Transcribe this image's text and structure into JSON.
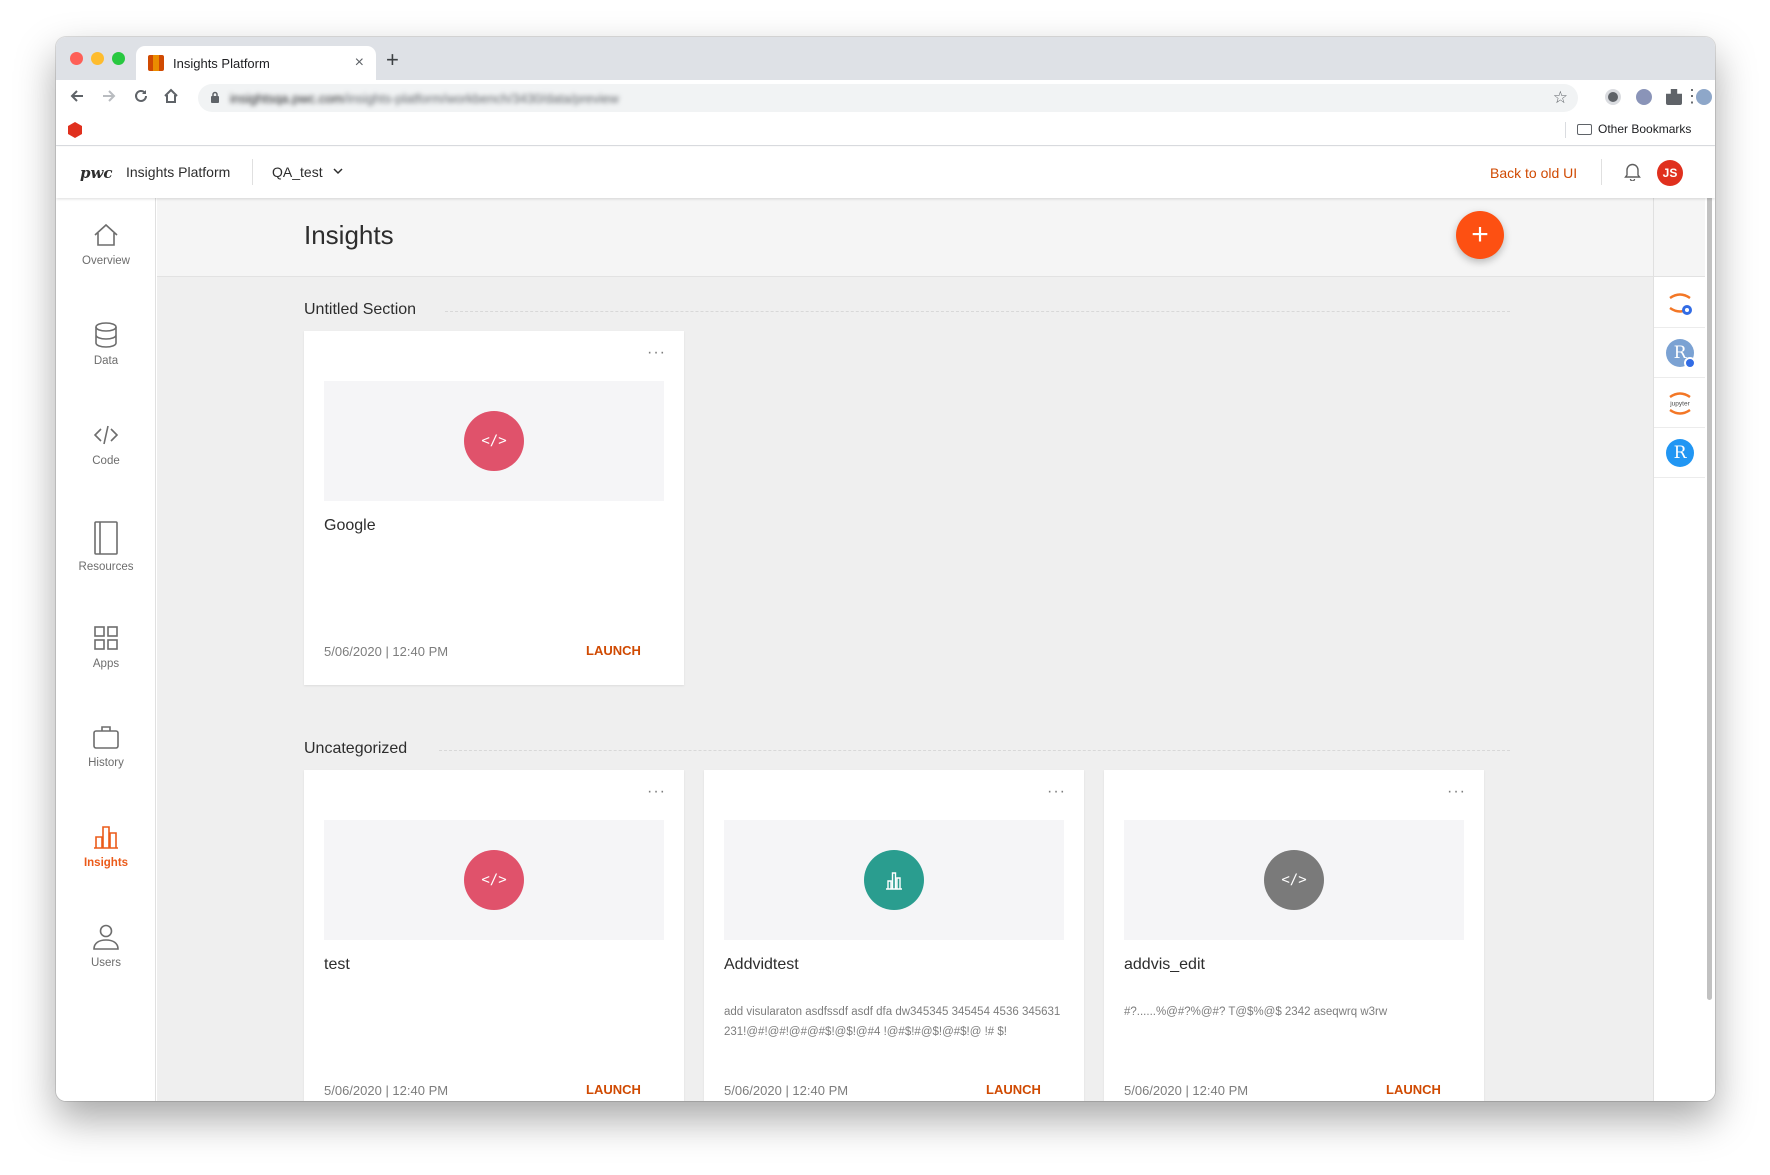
{
  "browser": {
    "tab_title": "Insights Platform",
    "tab_close": "×",
    "new_tab": "+",
    "url_host": "insightsqa.pwc.com",
    "url_path": "/insights-platform/workbench/3430/data/preview",
    "bookmark_other": "Other Bookmarks",
    "traffic_lights": [
      "#fe5f57",
      "#febc2e",
      "#28c840"
    ]
  },
  "header": {
    "logo": "pwc",
    "app_name": "Insights Platform",
    "workspace": "QA_test",
    "back_link": "Back to old UI",
    "avatar_initials": "JS"
  },
  "sidenav": {
    "items": [
      {
        "label": "Overview",
        "icon": "home-icon"
      },
      {
        "label": "Data",
        "icon": "database-icon"
      },
      {
        "label": "Code",
        "icon": "code-icon"
      },
      {
        "label": "Resources",
        "icon": "book-icon"
      },
      {
        "label": "Apps",
        "icon": "grid-icon"
      },
      {
        "label": "History",
        "icon": "briefcase-icon"
      },
      {
        "label": "Insights",
        "icon": "bar-chart-icon",
        "active": true
      },
      {
        "label": "Users",
        "icon": "user-icon"
      }
    ]
  },
  "main": {
    "title": "Insights",
    "fab_label": "+",
    "sections": [
      {
        "title": "Untitled Section",
        "cards": [
          {
            "title": "Google",
            "icon": "</>",
            "icon_color": "#e0526b",
            "description": "",
            "date": "5/06/2020 | 12:40 PM",
            "action": "LAUNCH"
          }
        ]
      },
      {
        "title": "Uncategorized",
        "cards": [
          {
            "title": "test",
            "icon": "</>",
            "icon_color": "#e0526b",
            "description": "",
            "date": "5/06/2020 | 12:40 PM",
            "action": "LAUNCH"
          },
          {
            "title": "Addvidtest",
            "icon": "bar-chart-icon",
            "icon_color": "#2a9d8f",
            "description": "add visularaton asdfssdf asdf dfa dw345345 345454 4536 345631231!@#!@#!@#@#$!@$!@#4 !@#$!#@$!@#$!@ !# $!",
            "date": "5/06/2020 | 12:40 PM",
            "action": "LAUNCH"
          },
          {
            "title": "addvis_edit",
            "icon": "</>",
            "icon_color": "#7a7a7a",
            "description": "#?......%@#?%@#? T@$%@$ 2342 aseqwrq w3rw",
            "date": "5/06/2020 | 12:40 PM",
            "action": "LAUNCH"
          }
        ]
      }
    ]
  },
  "rail": {
    "items": [
      "jupyter-k8s-icon",
      "r-k8s-icon",
      "jupyter-icon",
      "r-icon"
    ],
    "r_letter": "R",
    "jupyter_word": "jupyter"
  },
  "colors": {
    "accent": "#d04a02",
    "fab": "#fd5012",
    "active_nav": "#eb5b1a"
  }
}
